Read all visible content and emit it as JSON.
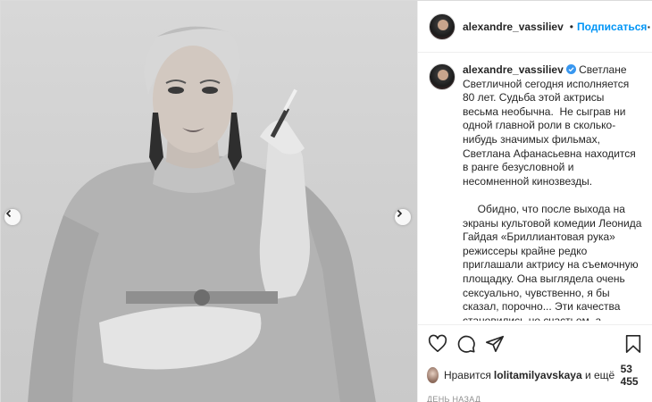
{
  "post": {
    "username": "alexandre_vassiliev",
    "dot": "•",
    "follow_label": "Подписаться",
    "more_label": "···"
  },
  "caption": {
    "username": "alexandre_vassiliev",
    "text": " Светлане Светличной сегодня исполняется 80 лет. Судьба этой актрисы весьма необычна.  Не сыграв ни одной главной роли в сколько-нибудь значимых фильмах, Светлана Афанасьевна находится в ранге безусловной и несомненной кинозвезды.\n\n     Обидно, что после выхода на экраны культовой комедии Леонида Гайдая «Бриллиантовая рука» режиссеры крайне редко приглашали актрису на съемочную площадку. Она выглядела очень сексуально, чувственно, я бы сказал, порочно... Эти качества становились не счастьем, а наказанием для советских артисток, поскольку такой"
  },
  "likes": {
    "prefix": "Нравится ",
    "user": "lolitamilyavskaya",
    "middle": " и ещё ",
    "count": "53 455"
  },
  "date": "ДЕНЬ НАЗАД",
  "icons": {
    "like": "heart-icon",
    "comment": "comment-icon",
    "share": "share-icon",
    "save": "bookmark-icon",
    "prev": "chevron-left-icon",
    "next": "chevron-right-icon",
    "verified": "verified-badge-icon"
  },
  "colors": {
    "link": "#0095f6",
    "verified": "#3897f0",
    "text": "#262626",
    "muted": "#8e8e8e"
  }
}
